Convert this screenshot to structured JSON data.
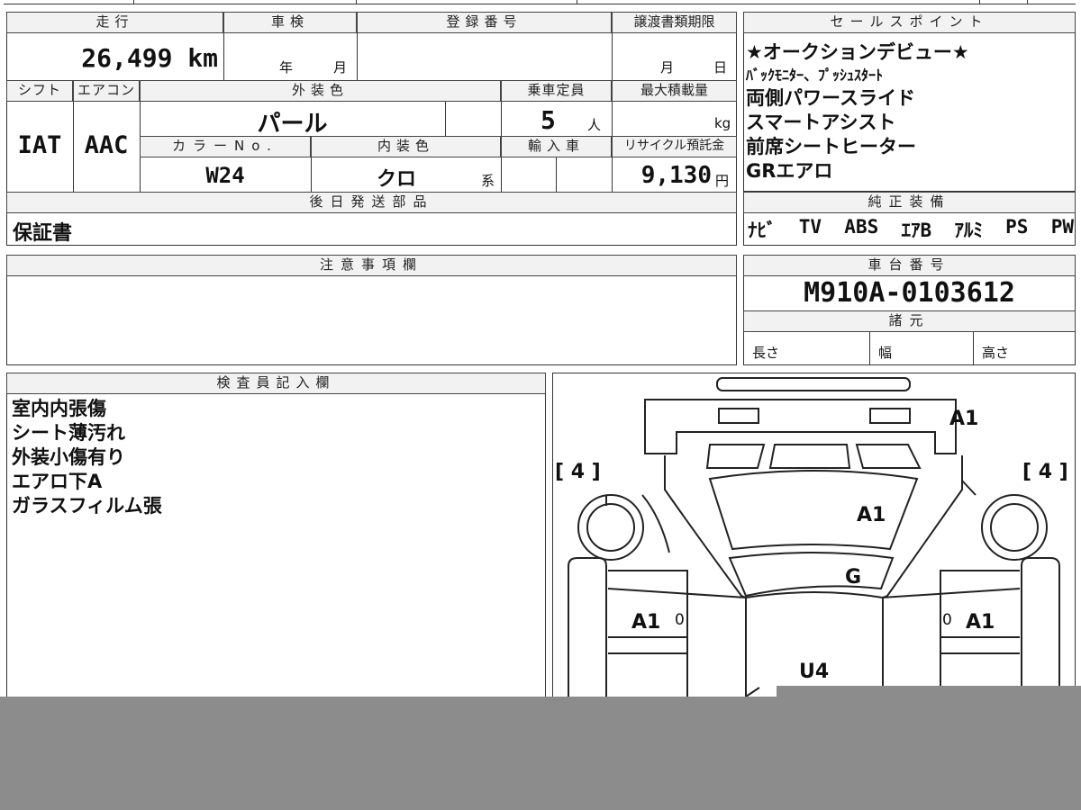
{
  "vehicle": {
    "mileage_label": "走行",
    "mileage": "26,499 km",
    "inspection_label": "車検",
    "inspection_year_unit": "年",
    "inspection_month_unit": "月",
    "registration_label": "登録番号",
    "transfer_label": "譲渡書類期限",
    "transfer_month_unit": "月",
    "transfer_day_unit": "日",
    "shift_label": "シフト",
    "shift": "IAT",
    "ac_label": "エアコン",
    "ac": "AAC",
    "exterior_color_label": "外装色",
    "exterior_color": "パール",
    "capacity_label": "乗車定員",
    "capacity": "5",
    "capacity_unit": "人",
    "max_load_label": "最大積載量",
    "max_load_unit": "kg",
    "color_no_label": "カラーNo.",
    "color_no": "W24",
    "interior_color_label": "内装色",
    "interior_color": "クロ",
    "interior_color_suffix": "系",
    "import_label": "輸入車",
    "recycle_label": "リサイクル預託金",
    "recycle_fee": "9,130",
    "recycle_unit": "円",
    "later_parts_label": "後日発送部品",
    "later_parts": "保証書"
  },
  "sales_points": {
    "label": "セールスポイント",
    "lines": [
      "★オークションデビュー★",
      "ﾊﾞｯｸﾓﾆﾀｰ、ﾌﾟｯｼｭｽﾀｰﾄ",
      "両側パワースライド",
      "スマートアシスト",
      "前席シートヒーター",
      "GRエアロ"
    ]
  },
  "equipment": {
    "label": "純正装備",
    "items": [
      "ﾅﾋﾞ",
      "TV",
      "ABS",
      "ｴｱB",
      "ｱﾙﾐ",
      "PS",
      "PW"
    ]
  },
  "notes": {
    "label": "注意事項欄"
  },
  "chassis": {
    "label": "車台番号",
    "number": "M910A-0103612",
    "specs_label": "諸元",
    "length_label": "長さ",
    "width_label": "幅",
    "height_label": "高さ"
  },
  "inspector": {
    "label": "検査員記入欄",
    "lines": [
      "室内内張傷",
      "シート薄汚れ",
      "外装小傷有り",
      "エアロ下A",
      "ガラスフィルム張"
    ]
  },
  "diagram": {
    "marks": {
      "top_right": "A1",
      "tire_left": "[ 4 ]",
      "tire_right": "[ 4 ]",
      "hood": "A1",
      "windshield": "G",
      "left_fender": "A1",
      "right_fender": "A1",
      "roof": "U4",
      "small_left": "0",
      "small_right": "0"
    }
  }
}
